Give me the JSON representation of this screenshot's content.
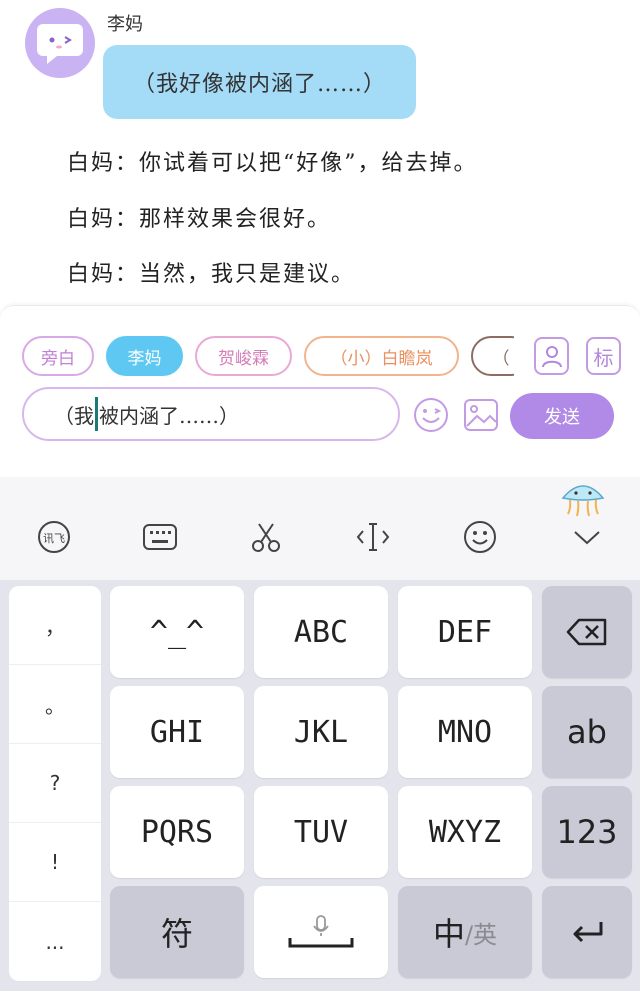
{
  "chat": {
    "sender_name": "李妈",
    "bubble_text": "（我好像被内涵了……）",
    "narration": [
      "白妈：你试着可以把“好像”，给去掉。",
      "白妈：那样效果会很好。",
      "白妈：当然，我只是建议。"
    ]
  },
  "panel": {
    "chips": [
      "旁白",
      "李妈",
      "贺峻霖",
      "（小）白瞻岚",
      "（"
    ],
    "input_before_cursor": "（我",
    "input_after_cursor": "被内涵了……）",
    "send_label": "发送",
    "label_icon_text": "标",
    "active_chip_color": "#5ec8f2",
    "send_color": "#b08ae6"
  },
  "keyboard": {
    "punctuation": [
      "，",
      "。",
      "?",
      "!",
      "..."
    ],
    "rows": [
      [
        "^_^",
        "ABC",
        "DEF"
      ],
      [
        "GHI",
        "JKL",
        "MNO"
      ],
      [
        "PQRS",
        "TUV",
        "WXYZ"
      ]
    ],
    "ab_label": "ab",
    "num_label": "123",
    "symbol_label": "符",
    "zh_label": "中",
    "en_label": "/英"
  }
}
